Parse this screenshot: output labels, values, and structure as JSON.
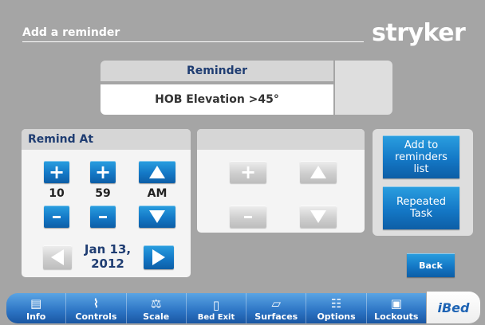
{
  "header": {
    "title": "Add a reminder",
    "logo": "stryker"
  },
  "reminder": {
    "label": "Reminder",
    "value": "HOB Elevation >45°"
  },
  "remind_at": {
    "label": "Remind At",
    "hour": "10",
    "minute": "59",
    "ampm": "AM",
    "date_line1": "Jan 13,",
    "date_line2": "2012"
  },
  "actions": {
    "add_to_list_line1": "Add to",
    "add_to_list_line2": "reminders",
    "add_to_list_line3": "list",
    "repeated_task_line1": "Repeated",
    "repeated_task_line2": "Task",
    "back": "Back"
  },
  "nav": {
    "items": [
      {
        "label": "Info",
        "icon": "document-icon"
      },
      {
        "label": "Controls",
        "icon": "bed-controls-icon"
      },
      {
        "label": "Scale",
        "icon": "scale-icon"
      },
      {
        "label": "Bed Exit",
        "icon": "bed-exit-icon"
      },
      {
        "label": "Surfaces",
        "icon": "surfaces-icon"
      },
      {
        "label": "Options",
        "icon": "options-sliders-icon"
      },
      {
        "label": "Lockouts",
        "icon": "lock-icon"
      }
    ],
    "brand": "iBed"
  },
  "colors": {
    "background": "#a5a5a5",
    "panel": "#f4f4f4",
    "accent_blue": "#1478c6",
    "heading_text": "#1f3d72"
  }
}
